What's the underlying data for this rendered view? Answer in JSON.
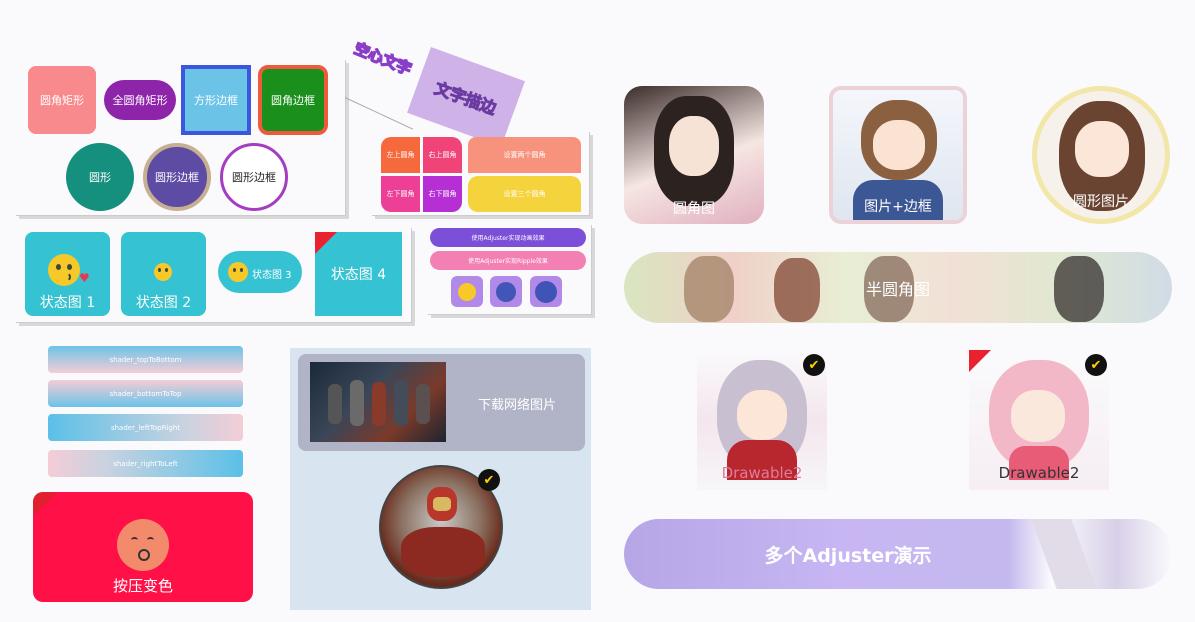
{
  "shapes": {
    "rounded_rect": "圆角矩形",
    "full_round_rect": "全圆角矩形",
    "square_border": "方形边框",
    "round_border": "圆角边框",
    "circle": "圆形",
    "circle_border_1": "圆形边框",
    "circle_border_2": "圆形边框"
  },
  "text_effects": {
    "hollow_text": "空心文字",
    "stroke_text": "文字描边"
  },
  "corners": {
    "top_left": "左上圆角",
    "top_right": "右上圆角",
    "bottom_left": "左下圆角",
    "bottom_right": "右下圆角",
    "two_corners": "设置两个圆角",
    "three_corners": "设置三个圆角"
  },
  "states": {
    "state1": "状态图 1",
    "state2": "状态图 2",
    "state3": "状态图 3",
    "state4": "状态图 4"
  },
  "adjuster": {
    "ripple": "使用Adjuster实现动画效果",
    "ripple2": "使用Adjuster实现Ripple效果"
  },
  "shaders": {
    "top_to_bottom": "shader_topToBottom",
    "bottom_to_top": "shader_bottomToTop",
    "left_top_right": "shader_leftTopRight",
    "right_to_left": "shader_rightToLeft"
  },
  "press": {
    "label": "按压变色"
  },
  "network": {
    "label": "下载网络图片"
  },
  "images": {
    "rounded": "圆角图",
    "image_border": "图片+边框",
    "circle_image": "圆形图片",
    "half_round": "半圆角图",
    "drawable1": "Drawable2",
    "drawable2": "Drawable2",
    "multi_adjuster": "多个Adjuster演示"
  },
  "colors": {
    "pink": "#f88a8e",
    "purple": "#8e24aa",
    "sky": "#6cc3e8",
    "green": "#1b8f1b",
    "teal": "#158f7e",
    "indigo": "#5d4ba4",
    "cyan": "#35c2d3",
    "red": "#ff1148",
    "lavender": "#c7b6f3"
  }
}
